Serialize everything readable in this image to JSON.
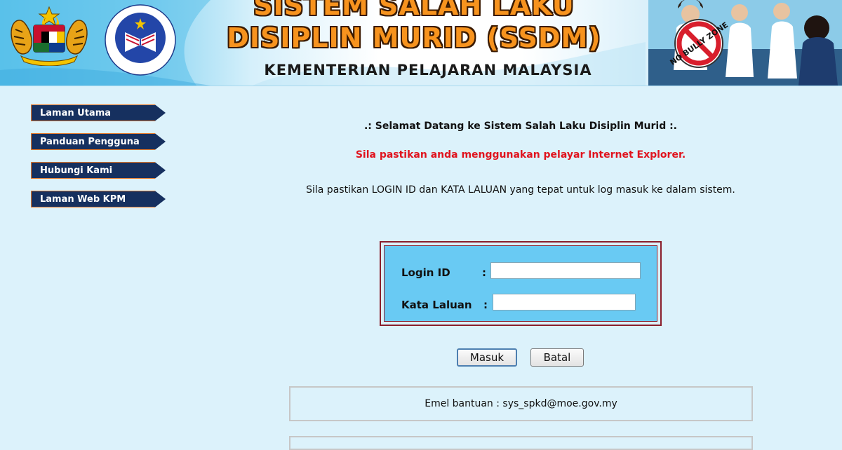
{
  "banner": {
    "title_line1": "SISTEM SALAH LAKU",
    "title_line2": "DISIPLIN MURID (SSDM)",
    "ministry": "KEMENTERIAN PELAJARAN MALAYSIA",
    "logo_text": "KEMENTERIAN PELAJARAN MALAYSIA",
    "badge_text": "NO BULLY ZONE",
    "title_color": "#f7931e"
  },
  "sidebar": {
    "items": [
      {
        "label": "Laman Utama",
        "icon": "arrow-tab"
      },
      {
        "label": "Panduan Pengguna",
        "icon": "arrow-tab"
      },
      {
        "label": "Hubungi Kami",
        "icon": "arrow-tab"
      },
      {
        "label": "Laman Web KPM",
        "icon": "arrow-tab"
      }
    ],
    "bg_color": "#16305f",
    "border_color": "#e6792a"
  },
  "main": {
    "welcome": ".: Selamat Datang ke Sistem Salah Laku Disiplin Murid :.",
    "warning": "Sila pastikan anda menggunakan pelayar Internet Explorer.",
    "instruction": "Sila pastikan LOGIN ID dan KATA LALUAN yang tepat untuk log masuk ke dalam sistem.",
    "warning_color": "#e0141e"
  },
  "login": {
    "login_id_label": "Login ID",
    "password_label": "Kata Laluan",
    "colon": ":",
    "login_id_value": "",
    "password_value": "",
    "box_color": "#69caf3",
    "frame_color": "#8a1e2b"
  },
  "buttons": {
    "submit_label": "Masuk",
    "cancel_label": "Batal"
  },
  "help": {
    "text": "Emel bantuan : sys_spkd@moe.gov.my"
  }
}
